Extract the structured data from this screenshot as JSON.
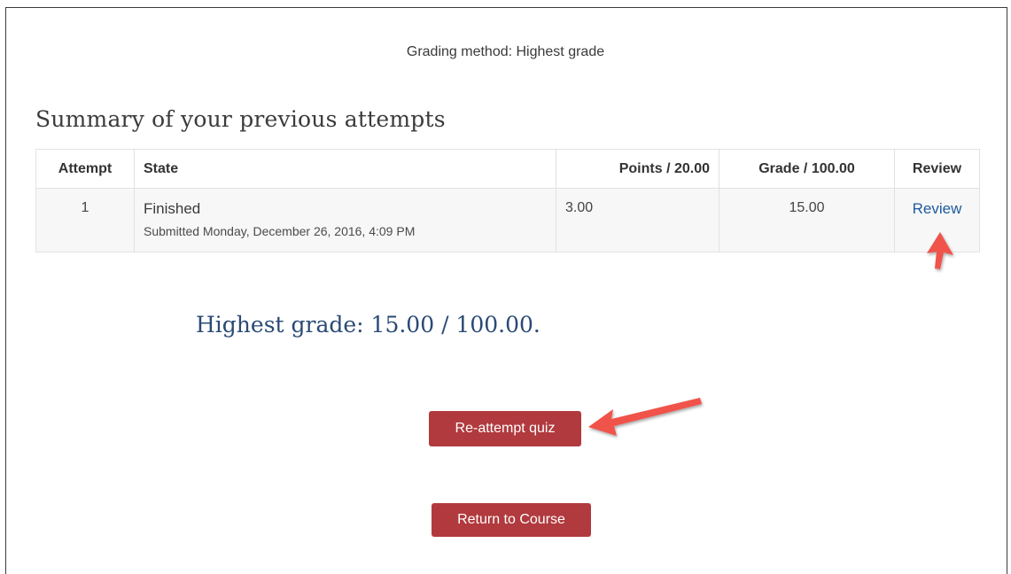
{
  "grading_method": "Grading method: Highest grade",
  "summary_heading": "Summary of your previous attempts",
  "table": {
    "headers": {
      "attempt": "Attempt",
      "state": "State",
      "points": "Points / 20.00",
      "grade": "Grade / 100.00",
      "review": "Review"
    },
    "rows": [
      {
        "attempt": "1",
        "state": "Finished",
        "submitted": "Submitted Monday, December 26, 2016, 4:09 PM",
        "points": "3.00",
        "grade": "15.00",
        "review": "Review"
      }
    ]
  },
  "highest_grade": "Highest grade: 15.00 / 100.00.",
  "buttons": {
    "reattempt": "Re-attempt quiz",
    "return": "Return to Course"
  },
  "colors": {
    "button_bg": "#b13a3e",
    "link": "#1e5a9c",
    "highest_grade_text": "#2a4a75",
    "annotation_arrow": "#f0524a"
  },
  "annotations": {
    "review_arrow_icon": "arrow-up-icon",
    "reattempt_arrow_icon": "arrow-left-icon"
  }
}
